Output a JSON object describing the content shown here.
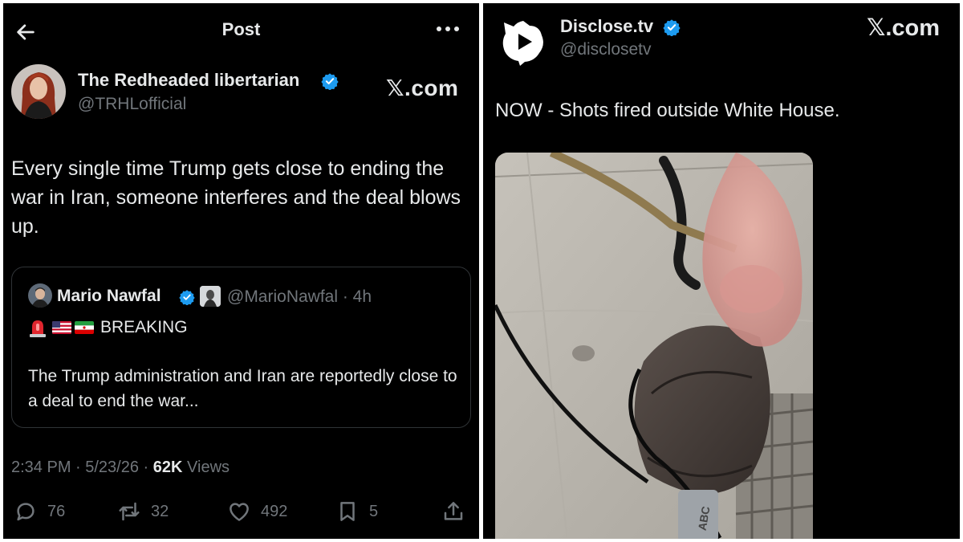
{
  "left_post": {
    "header": {
      "title": "Post",
      "back_icon": "back-arrow-icon",
      "more_icon": "more-dots-icon"
    },
    "author": {
      "name": "The Redheaded libertarian",
      "handle": "@TRHLofficial",
      "verified": true
    },
    "watermark": "𝕏.com",
    "text": "Every single time Trump gets close to ending the war in Iran, someone interferes and the deal blows up.",
    "quote": {
      "name": "Mario Nawfal",
      "handle_time": "@MarioNawfal · 4h",
      "breaking": "BREAKING",
      "flags": [
        "us-flag-icon",
        "iran-flag-icon"
      ],
      "body": "The Trump administration and Iran are reportedly close to a deal to end the war..."
    },
    "meta": {
      "time_date": "2:34 PM · 5/23/26 · ",
      "views_count": "62K",
      "views_label": " Views"
    },
    "actions": {
      "replies": "76",
      "reposts": "32",
      "likes": "492",
      "bookmarks": "5"
    }
  },
  "right_post": {
    "author": {
      "name": "Disclose.tv",
      "handle": "@disclosetv",
      "verified": true
    },
    "watermark": "𝕏.com",
    "text": "NOW - Shots fired outside White House.",
    "media_label": "ABC"
  },
  "colors": {
    "background": "#000000",
    "text": "#e7e9ea",
    "secondary": "#71767b",
    "verified": "#1d9bf0",
    "border": "#2f3336"
  }
}
